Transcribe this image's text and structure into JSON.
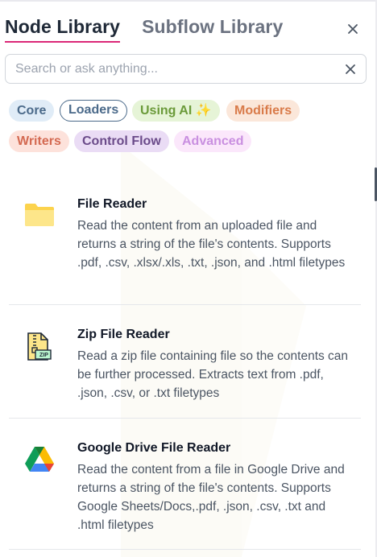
{
  "tabs": {
    "node_library": "Node Library",
    "subflow_library": "Subflow Library"
  },
  "search": {
    "placeholder": "Search or ask anything..."
  },
  "filters": {
    "core": "Core",
    "loaders": "Loaders",
    "using_ai": "Using AI ✨",
    "modifiers": "Modifiers",
    "writers": "Writers",
    "control_flow": "Control Flow",
    "advanced": "Advanced"
  },
  "nodes": [
    {
      "title": "File Reader",
      "description": "Read the content from an uploaded file and returns a string of the file's contents. Supports .pdf, .csv, .xlsx/.xls, .txt, .json, and .html filetypes",
      "icon": "folder-icon"
    },
    {
      "title": "Zip File Reader",
      "description": "Read a zip file containing file so the contents can be further processed. Extracts text from .pdf, .json, .csv, or .txt filetypes",
      "icon": "zip-file-icon",
      "icon_badge": "ZIP"
    },
    {
      "title": "Google Drive File Reader",
      "description": "Read the content from a file in Google Drive and returns a string of the file's contents. Supports Google Sheets/Docs,.pdf, .json, .csv, .txt and .html filetypes",
      "icon": "google-drive-icon"
    }
  ],
  "colors": {
    "active_tab_underline": "#db2777",
    "folder": "#fcd34d"
  }
}
